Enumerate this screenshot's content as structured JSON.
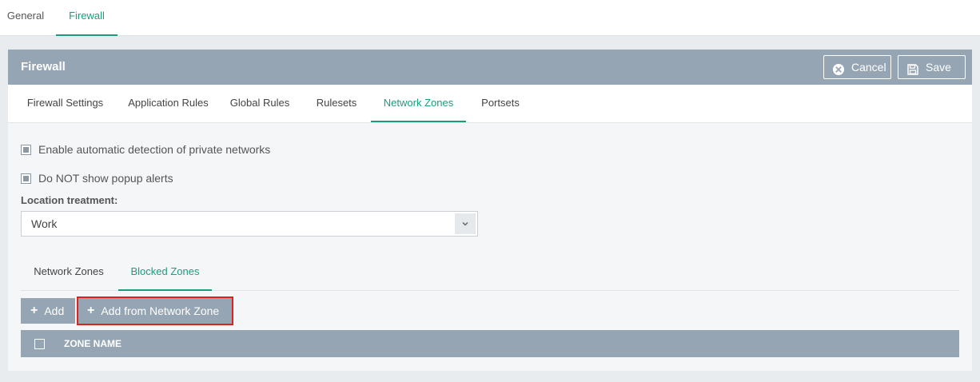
{
  "top_tabs": [
    {
      "label": "General",
      "active": false
    },
    {
      "label": "Firewall",
      "active": true
    }
  ],
  "panel": {
    "title": "Firewall",
    "cancel_label": "Cancel",
    "save_label": "Save"
  },
  "sub_tabs": [
    {
      "label": "Firewall Settings",
      "active": false
    },
    {
      "label": "Application Rules",
      "active": false
    },
    {
      "label": "Global Rules",
      "active": false
    },
    {
      "label": "Rulesets",
      "active": false
    },
    {
      "label": "Network Zones",
      "active": true
    },
    {
      "label": "Portsets",
      "active": false
    }
  ],
  "options": {
    "auto_detect_label": "Enable automatic detection of private networks",
    "auto_detect_checked": true,
    "no_popup_label": "Do NOT show popup alerts",
    "no_popup_checked": true
  },
  "location": {
    "label": "Location treatment:",
    "value": "Work"
  },
  "inner_tabs": [
    {
      "label": "Network Zones",
      "active": false
    },
    {
      "label": "Blocked Zones",
      "active": true
    }
  ],
  "actions": {
    "add_label": "Add",
    "add_from_zone_label": "Add from Network Zone"
  },
  "table": {
    "columns": [
      "ZONE NAME"
    ],
    "rows": []
  },
  "colors": {
    "accent": "#1f9a7c",
    "header_bg": "#95a5b3",
    "highlight": "#e0201e"
  },
  "icons": {
    "cancel": "close-circle-icon",
    "save": "floppy-disk-icon",
    "dropdown": "chevron-down-icon",
    "add": "plus-icon"
  }
}
